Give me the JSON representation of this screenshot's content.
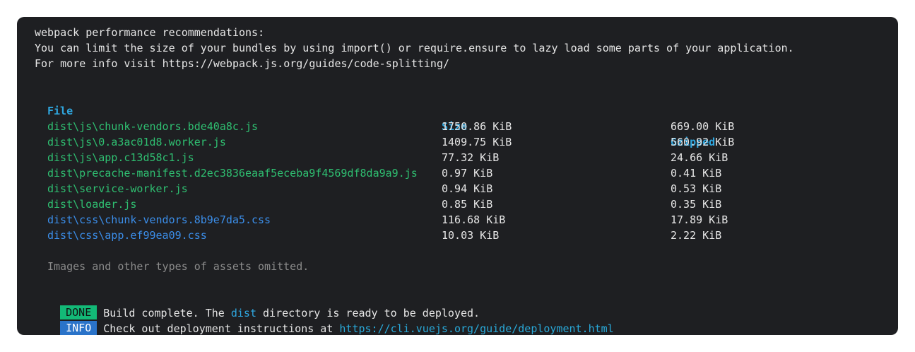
{
  "header": {
    "line1": "webpack performance recommendations:",
    "line2": "You can limit the size of your bundles by using import() or require.ensure to lazy load some parts of your application.",
    "line3": "For more info visit https://webpack.js.org/guides/code-splitting/"
  },
  "table": {
    "columns": [
      "File",
      "Size",
      "Gzipped"
    ],
    "rows": [
      {
        "file": "dist\\js\\chunk-vendors.bde40a8c.js",
        "size": "1750.86 KiB",
        "gzipped": "669.00 KiB",
        "kind": "js"
      },
      {
        "file": "dist\\js\\0.a3ac01d8.worker.js",
        "size": "1409.75 KiB",
        "gzipped": "560.92 KiB",
        "kind": "js"
      },
      {
        "file": "dist\\js\\app.c13d58c1.js",
        "size": "77.32 KiB",
        "gzipped": "24.66 KiB",
        "kind": "js"
      },
      {
        "file": "dist\\precache-manifest.d2ec3836eaaf5eceba9f4569df8da9a9.js",
        "size": "0.97 KiB",
        "gzipped": "0.41 KiB",
        "kind": "js"
      },
      {
        "file": "dist\\service-worker.js",
        "size": "0.94 KiB",
        "gzipped": "0.53 KiB",
        "kind": "js"
      },
      {
        "file": "dist\\loader.js",
        "size": "0.85 KiB",
        "gzipped": "0.35 KiB",
        "kind": "js"
      },
      {
        "file": "dist\\css\\chunk-vendors.8b9e7da5.css",
        "size": "116.68 KiB",
        "gzipped": "17.89 KiB",
        "kind": "css"
      },
      {
        "file": "dist\\css\\app.ef99ea09.css",
        "size": "10.03 KiB",
        "gzipped": "2.22 KiB",
        "kind": "css"
      }
    ],
    "footnote": "Images and other types of assets omitted."
  },
  "status": {
    "done_badge": "DONE",
    "done_prefix": "Build complete. The ",
    "done_dir": "dist",
    "done_suffix": " directory is ready to be deployed.",
    "info_badge": "INFO",
    "info_prefix": "Check out deployment instructions at ",
    "info_link": "https://cli.vuejs.org/guide/deployment.html"
  },
  "colors": {
    "background": "#1e1f22",
    "header_text": "#2fa7e0",
    "js_file": "#2fbf71",
    "css_file": "#3b8eea",
    "done_badge": "#13b977",
    "info_badge": "#2a73c9"
  }
}
